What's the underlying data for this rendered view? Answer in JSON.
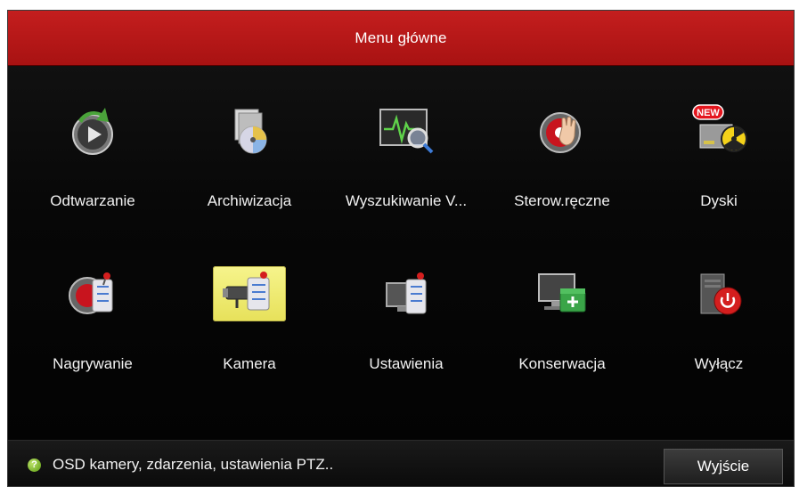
{
  "window": {
    "title": "Menu główne"
  },
  "menu": {
    "items": [
      {
        "label": "Odtwarzanie",
        "icon": "playback-icon"
      },
      {
        "label": "Archiwizacja",
        "icon": "backup-disc-icon"
      },
      {
        "label": "Wyszukiwanie V...",
        "icon": "vca-search-icon"
      },
      {
        "label": "Sterow.ręczne",
        "icon": "manual-control-icon"
      },
      {
        "label": "Dyski",
        "icon": "hdd-icon",
        "badge": "NEW"
      },
      {
        "label": "Nagrywanie",
        "icon": "record-settings-icon"
      },
      {
        "label": "Kamera",
        "icon": "camera-settings-icon",
        "selected": true
      },
      {
        "label": "Ustawienia",
        "icon": "configuration-icon"
      },
      {
        "label": "Konserwacja",
        "icon": "maintenance-icon"
      },
      {
        "label": "Wyłącz",
        "icon": "shutdown-icon"
      }
    ]
  },
  "footer": {
    "hint_icon": "?",
    "hint": "OSD kamery, zdarzenia, ustawienia PTZ..",
    "exit_label": "Wyjście"
  },
  "colors": {
    "title_bar": "#b81818",
    "background": "#050505",
    "selected_tile": "#eeea70"
  }
}
